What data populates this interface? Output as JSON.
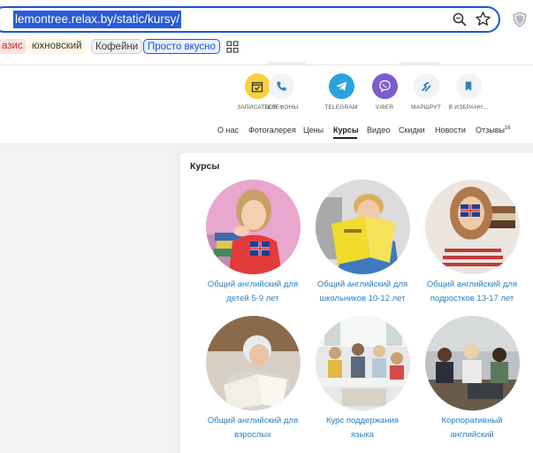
{
  "browser": {
    "url": "lemontree.relax.by/static/kursy/",
    "bookmarks": [
      "азис",
      "юхновский",
      "Кофейни",
      "Просто вкусно"
    ]
  },
  "header_icons": [
    {
      "label": "ЗАПИСАТЬСЯ",
      "icon": "calendar-check-icon",
      "color": "#f6d13a"
    },
    {
      "label": "ТЕЛЕФОНЫ",
      "icon": "phone-icon",
      "color": "#f0f4f8"
    },
    {
      "label": "TELEGRAM",
      "icon": "telegram-icon",
      "color": "#2aa3dd"
    },
    {
      "label": "VIBER",
      "icon": "viber-icon",
      "color": "#7b5cc9"
    },
    {
      "label": "МАРШРУТ",
      "icon": "route-icon",
      "color": "#f0f4f8"
    },
    {
      "label": "В ИЗБРАНН...",
      "icon": "bookmark-icon",
      "color": "#f0f4f8"
    }
  ],
  "nav": {
    "items": [
      "О нас",
      "Фотогалерея",
      "Цены",
      "Курсы",
      "Видео",
      "Скидки",
      "Новости",
      "Отзывы"
    ],
    "active": "Курсы",
    "reviews_count": "16"
  },
  "section": {
    "title": "Курсы",
    "courses": [
      {
        "line1": "Общий английский для",
        "line2": "детей 5-9 лет"
      },
      {
        "line1": "Общий английский для",
        "line2": "школьников 10-12 лет"
      },
      {
        "line1": "Общий английский для",
        "line2": "подростков 13-17 лет"
      },
      {
        "line1": "Общий английский для",
        "line2": "взрослых"
      },
      {
        "line1": "Курс поддержания",
        "line2": "языка"
      },
      {
        "line1": "Корпоративный",
        "line2": "английский"
      }
    ]
  }
}
